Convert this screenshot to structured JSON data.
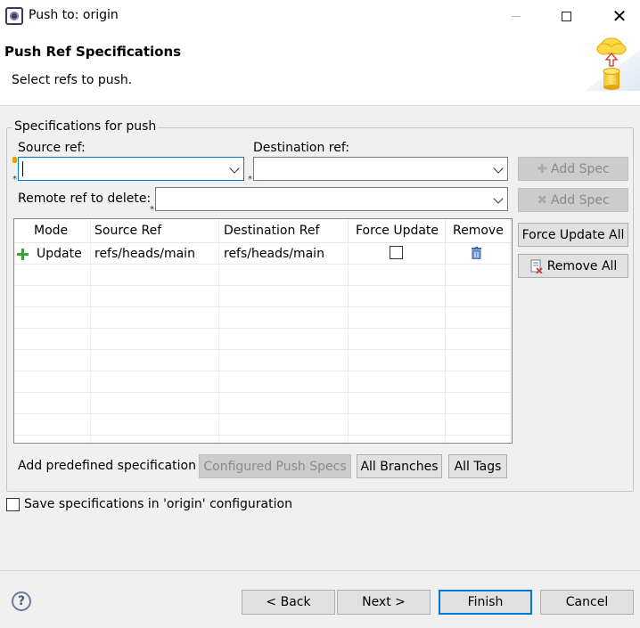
{
  "window": {
    "title": "Push to: origin",
    "minimize_icon": "minimize-icon",
    "maximize_icon": "maximize-icon",
    "close_icon": "close-icon"
  },
  "header": {
    "title": "Push Ref Specifications",
    "subtitle": "Select refs to push.",
    "banner_icon": "cloud-push-database-icon"
  },
  "specs_group": {
    "label": "Specifications for push",
    "source_ref_label": "Source ref:",
    "source_ref_value": "",
    "destination_ref_label": "Destination ref:",
    "destination_ref_value": "",
    "remote_delete_label": "Remote ref to delete:",
    "remote_delete_value": "",
    "required_marker": "*",
    "add_spec_label_1": "Add Spec",
    "add_spec_label_2": "Add Spec",
    "force_update_all_label": "Force Update All",
    "remove_all_label": "Remove All"
  },
  "table": {
    "columns": [
      "Mode",
      "Source Ref",
      "Destination Ref",
      "Force Update",
      "Remove"
    ],
    "rows": [
      {
        "mode": "Update",
        "source": "refs/heads/main",
        "destination": "refs/heads/main",
        "force_update": false,
        "remove_icon": "trash-icon"
      }
    ]
  },
  "predefined": {
    "label": "Add predefined specification",
    "configured_push_specs": "Configured Push Specs",
    "all_branches": "All Branches",
    "all_tags": "All Tags"
  },
  "save_config": {
    "label": "Save specifications in 'origin' configuration",
    "checked": false
  },
  "footer": {
    "help_icon": "help-icon",
    "back": "< Back",
    "next": "Next >",
    "finish": "Finish",
    "cancel": "Cancel"
  },
  "colors": {
    "accent": "#0078d7",
    "dialog_bg": "#f0f0f0",
    "add_icon_green": "#3aa135",
    "trash_blue": "#3d6db5"
  }
}
